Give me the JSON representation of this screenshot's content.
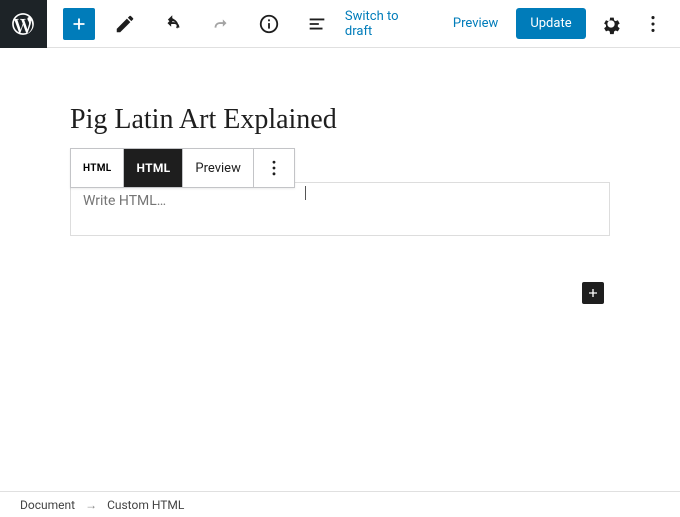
{
  "header": {
    "switch_draft": "Switch to draft",
    "preview": "Preview",
    "update": "Update"
  },
  "document": {
    "title": "Pig Latin Art Explained"
  },
  "block_toolbar": {
    "type_indicator": "HTML",
    "html_tab": "HTML",
    "preview_tab": "Preview"
  },
  "html_block": {
    "placeholder": "Write HTML…",
    "value": ""
  },
  "breadcrumb": {
    "root": "Document",
    "current": "Custom HTML"
  }
}
